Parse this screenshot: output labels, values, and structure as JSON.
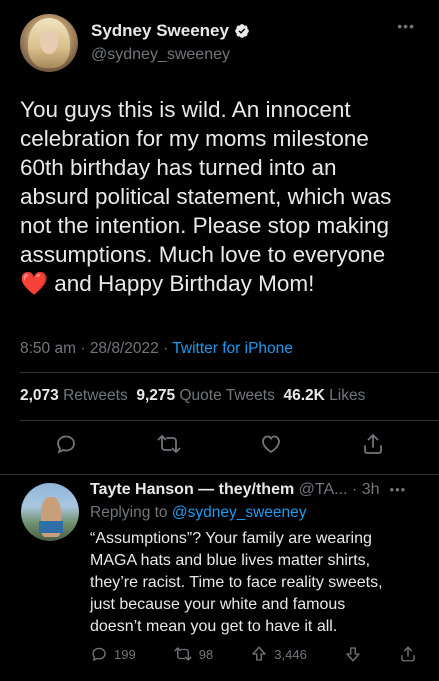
{
  "tweet": {
    "author_name": "Sydney Sweeney",
    "author_handle": "@sydney_sweeney",
    "text": "You guys this is wild. An innocent\ncelebration for my moms milestone\n60th birthday has turned into an\nabsurd political statement, which was\nnot the intention. Please stop making\nassumptions. Much love to everyone",
    "text_last_line": " and Happy Birthday Mom!",
    "heart_emoji": "❤️",
    "time": "8:50 am",
    "date": "28/8/2022",
    "separator": "·",
    "source": "Twitter for iPhone",
    "retweets_count": "2,073",
    "retweets_label": "Retweets",
    "quote_count": "9,275",
    "quote_label": "Quote Tweets",
    "likes_count": "46.2K",
    "likes_label": "Likes",
    "more_icon": "more-horizontal-icon",
    "verified_icon": "verified-badge-icon"
  },
  "actions": [
    {
      "icon": "reply-icon"
    },
    {
      "icon": "retweet-icon"
    },
    {
      "icon": "like-icon"
    },
    {
      "icon": "share-icon"
    }
  ],
  "reply": {
    "author_name": "Tayte Hanson — they/them",
    "author_handle": "@TA...",
    "separator": "·",
    "time": "3h",
    "replying_to_label": "Replying to",
    "replying_to_handle": "@sydney_sweeney",
    "text": "“Assumptions”? Your family are wearing\nMAGA hats and blue lives matter shirts,\nthey’re racist. Time to face reality sweets,\njust because your white and famous\ndoesn’t mean you get to have it all.",
    "reply_count": "199",
    "retweet_count": "98",
    "like_count": "3,446"
  },
  "colors": {
    "background": "#000000",
    "text": "#e7e9ea",
    "secondary": "#71767b",
    "accent": "#1d9bf0",
    "heart": "#f4212e"
  }
}
